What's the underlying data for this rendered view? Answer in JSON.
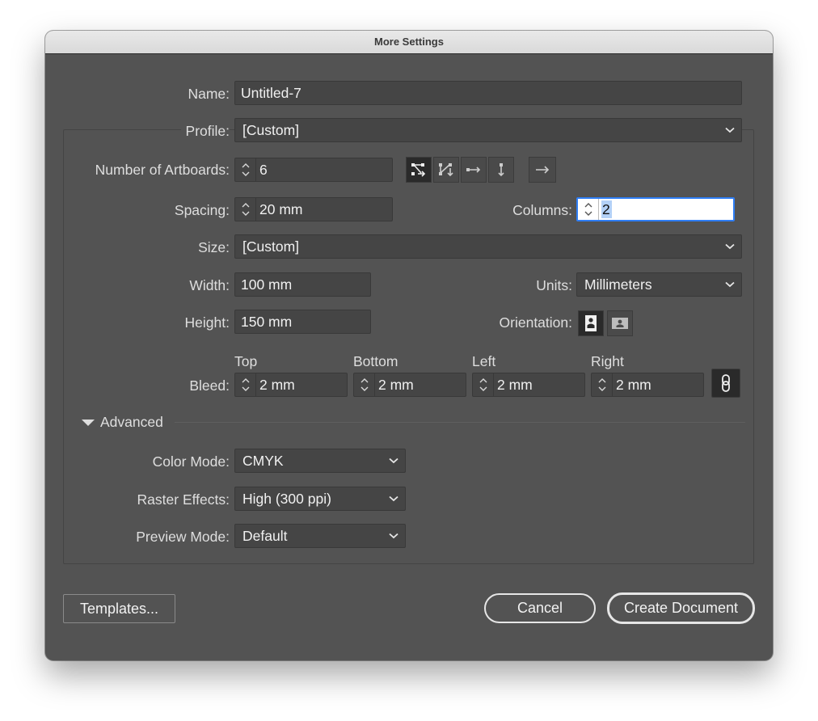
{
  "window": {
    "title": "More Settings"
  },
  "name": {
    "label": "Name:",
    "value": "Untitled-7"
  },
  "profile": {
    "label": "Profile:",
    "value": "[Custom]"
  },
  "artboards": {
    "label": "Number of Artboards:",
    "value": "6",
    "layout_icons": [
      "grid-by-row-icon",
      "grid-by-column-icon",
      "arrange-by-row-icon",
      "arrange-by-column-icon",
      "right-to-left-layout-icon"
    ]
  },
  "spacing": {
    "label": "Spacing:",
    "value": "20 mm"
  },
  "columns": {
    "label": "Columns:",
    "value": "2"
  },
  "size": {
    "label": "Size:",
    "value": "[Custom]"
  },
  "width": {
    "label": "Width:",
    "value": "100 mm"
  },
  "height": {
    "label": "Height:",
    "value": "150 mm"
  },
  "units": {
    "label": "Units:",
    "value": "Millimeters"
  },
  "orientation": {
    "label": "Orientation:",
    "selected": "portrait"
  },
  "bleed": {
    "label": "Bleed:",
    "top_label": "Top",
    "top": "2 mm",
    "bottom_label": "Bottom",
    "bottom": "2 mm",
    "left_label": "Left",
    "left": "2 mm",
    "right_label": "Right",
    "right": "2 mm"
  },
  "advanced": {
    "label": "Advanced",
    "color_mode": {
      "label": "Color Mode:",
      "value": "CMYK"
    },
    "raster_effects": {
      "label": "Raster Effects:",
      "value": "High (300 ppi)"
    },
    "preview_mode": {
      "label": "Preview Mode:",
      "value": "Default"
    }
  },
  "buttons": {
    "templates": "Templates...",
    "cancel": "Cancel",
    "create": "Create Document"
  },
  "colors": {
    "dialog_bg": "#535353",
    "field_bg": "#454545",
    "focus": "#2f7ef5"
  }
}
